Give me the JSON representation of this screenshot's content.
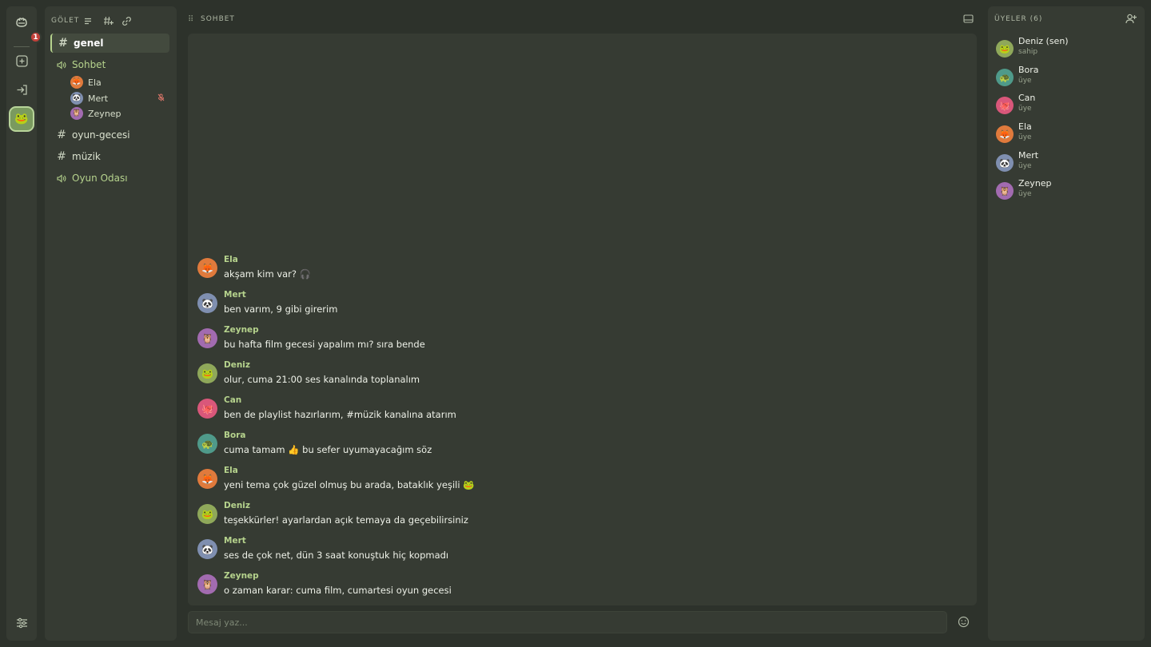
{
  "rail": {
    "home_badge": "1",
    "items": [
      {
        "name": "home",
        "icon": "frog-icon"
      },
      {
        "name": "add-server",
        "icon": "plus-square-icon"
      },
      {
        "name": "join-server",
        "icon": "login-icon"
      },
      {
        "name": "server-golet",
        "icon": "frog-server-icon"
      },
      {
        "name": "settings",
        "icon": "sliders-icon"
      }
    ]
  },
  "server": {
    "name": "GÖLET",
    "channels": [
      {
        "type": "text",
        "label": "genel",
        "active": true
      },
      {
        "type": "voice",
        "label": "Sohbet",
        "users": [
          {
            "name": "Ela",
            "color": "#e07a3c",
            "emoji": "🦊"
          },
          {
            "name": "Mert",
            "color": "#7f8fb0",
            "emoji": "🐼",
            "muted": true
          },
          {
            "name": "Zeynep",
            "color": "#a26bb0",
            "emoji": "🦉"
          }
        ]
      },
      {
        "type": "text",
        "label": "oyun-gecesi"
      },
      {
        "type": "text",
        "label": "müzik"
      },
      {
        "type": "voice",
        "label": "Oyun Odası"
      }
    ]
  },
  "chat": {
    "title": "SOHBET",
    "messages": [
      {
        "author": "Ela",
        "text": "akşam kim var? 🎧",
        "color": "#e07a3c",
        "emoji": "🦊"
      },
      {
        "author": "Mert",
        "text": "ben varım, 9 gibi girerim",
        "color": "#7f8fb0",
        "emoji": "🐼"
      },
      {
        "author": "Zeynep",
        "text": "bu hafta film gecesi yapalım mı? sıra bende",
        "color": "#a26bb0",
        "emoji": "🦉"
      },
      {
        "author": "Deniz",
        "text": "olur, cuma 21:00 ses kanalında toplanalım",
        "color": "#8fa85a",
        "emoji": "🐸"
      },
      {
        "author": "Can",
        "text": "ben de playlist hazırlarım, #müzik kanalına atarım",
        "color": "#d9577a",
        "emoji": "🐙"
      },
      {
        "author": "Bora",
        "text": "cuma tamam 👍 bu sefer uyumayacağım söz",
        "color": "#4f9a8a",
        "emoji": "🐢"
      },
      {
        "author": "Ela",
        "text": "yeni tema çok güzel olmuş bu arada, bataklık yeşili 🐸",
        "color": "#e07a3c",
        "emoji": "🦊"
      },
      {
        "author": "Deniz",
        "text": "teşekkürler! ayarlardan açık temaya da geçebilirsiniz",
        "color": "#8fa85a",
        "emoji": "🐸"
      },
      {
        "author": "Mert",
        "text": "ses de çok net, dün 3 saat konuştuk hiç kopmadı",
        "color": "#7f8fb0",
        "emoji": "🐼"
      },
      {
        "author": "Zeynep",
        "text": "o zaman karar: cuma film, cumartesi oyun gecesi",
        "color": "#a26bb0",
        "emoji": "🦉"
      }
    ],
    "composer_placeholder": "Mesaj yaz..."
  },
  "members": {
    "title": "ÜYELER (6)",
    "list": [
      {
        "name": "Deniz (sen)",
        "role": "sahip",
        "color": "#8fa85a",
        "emoji": "🐸"
      },
      {
        "name": "Bora",
        "role": "üye",
        "color": "#4f9a8a",
        "emoji": "🐢"
      },
      {
        "name": "Can",
        "role": "üye",
        "color": "#d9577a",
        "emoji": "🐙"
      },
      {
        "name": "Ela",
        "role": "üye",
        "color": "#e07a3c",
        "emoji": "🦊"
      },
      {
        "name": "Mert",
        "role": "üye",
        "color": "#7f8fb0",
        "emoji": "🐼"
      },
      {
        "name": "Zeynep",
        "role": "üye",
        "color": "#a26bb0",
        "emoji": "🦉"
      }
    ]
  },
  "theme": {
    "accent": "#b6d38d",
    "background": "#2d322b",
    "panel": "#363b33"
  }
}
